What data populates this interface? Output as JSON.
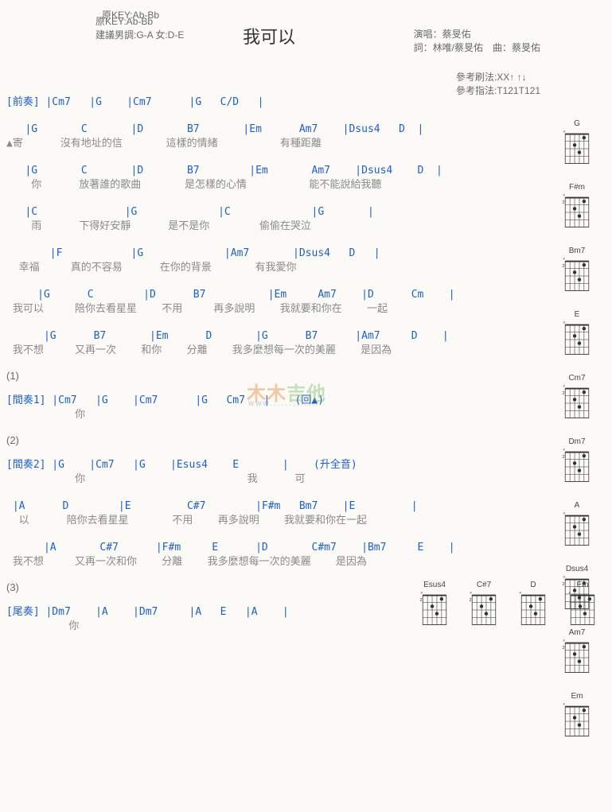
{
  "title": "我可以",
  "meta": {
    "original_key": "原KEY:Ab-Bb",
    "suggest_key": "建議男調:G-A 女:D-E",
    "singer_label": "演唱：蔡旻佑",
    "lyrics_label": "詞：林唯/蔡旻佑　曲：蔡旻佑",
    "ref_strum": "參考刷法:XX↑ ↑↓",
    "ref_finger": "參考指法:T121T121"
  },
  "lines": [
    {
      "type": "intro",
      "chords": "[前奏] |Cm7   |G    |Cm7      |G   C/D   |"
    },
    {
      "chords": "   |G       C       |D       B7       |Em      Am7    |Dsus4   D  |",
      "lyrics": "▲寄      沒有地址的信       這樣的情緒          有種距離"
    },
    {
      "chords": "   |G       C       |D       B7        |Em       Am7    |Dsus4    D  |",
      "lyrics": "    你      放著誰的歌曲       是怎樣的心情          能不能說給我聽"
    },
    {
      "chords": "   |C              |G             |C             |G       |",
      "lyrics": "    雨      下得好安靜      是不是你        偷偷在哭泣"
    },
    {
      "chords": "       |F           |G             |Am7       |Dsus4   D   |",
      "lyrics": "  幸福     真的不容易      在你的背景       有我愛你"
    },
    {
      "chords": "     |G      C        |D      B7          |Em     Am7    |D      Cm    |",
      "lyrics": " 我可以     陪你去看星星    不用     再多說明    我就要和你在    一起"
    },
    {
      "chords": "      |G      B7       |Em      D       |G      B7      |Am7     D    |",
      "lyrics": " 我不想     又再一次    和你    分離    我多麼想每一次的美麗    是因為"
    },
    {
      "type": "num",
      "text": "(1)"
    },
    {
      "chords": "[間奏1] |Cm7   |G    |Cm7      |G   Cm7   |    (回▲)",
      "lyrics": "           你"
    },
    {
      "type": "num",
      "text": "(2)"
    },
    {
      "chords": "[間奏2] |G    |Cm7   |G    |Esus4    E       |    (升全音)",
      "lyrics": "           你                          我      可"
    },
    {
      "chords": " |A      D        |E         C#7        |F#m   Bm7    |E         |",
      "lyrics": "  以      陪你去看星星       不用    再多說明    我就要和你在一起"
    },
    {
      "chords": "      |A       C#7      |F#m     E      |D       C#m7    |Bm7     E    |",
      "lyrics": " 我不想     又再一次和你    分離    我多麼想每一次的美麗    是因為"
    },
    {
      "type": "num",
      "text": "(3)"
    },
    {
      "chords": "[尾奏] |Dm7    |A    |Dm7     |A   E   |A    |",
      "lyrics": "          你"
    }
  ],
  "sidebar_chords": [
    "G",
    "F#m",
    "Bm7",
    "E",
    "Cm7",
    "Dm7",
    "A",
    "Dsus4",
    "Am7",
    "Em"
  ],
  "bottom_chords": [
    "Esus4",
    "C#7",
    "D",
    "Em"
  ],
  "watermark": "木木吉他",
  "watermark_sub": "www............."
}
